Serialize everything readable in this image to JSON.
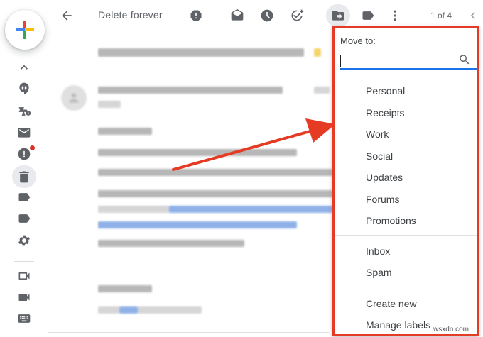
{
  "toolbar": {
    "back_icon": "arrow-left-icon",
    "delete_forever_label": "Delete forever",
    "report_spam_icon": "report-spam-icon",
    "mark_unread_icon": "mark-unread-icon",
    "snooze_icon": "clock-icon",
    "add_to_tasks_icon": "add-task-icon",
    "move_to_icon": "move-to-folder-icon",
    "labels_icon": "label-icon",
    "more_icon": "more-vertical-icon",
    "pager_text": "1 of 4",
    "prev_icon": "chevron-left-icon"
  },
  "rail": {
    "compose_icon": "compose-plus-icon",
    "icons": [
      "chevron-up-icon",
      "hangouts-icon",
      "snoozed-icon",
      "mail-icon",
      "important-icon",
      "trash-icon",
      "label-icon",
      "label-icon",
      "settings-icon",
      "video-icon",
      "meet-icon",
      "keyboard-icon"
    ]
  },
  "move_to": {
    "title": "Move to:",
    "search_value": "",
    "labels": [
      "Personal",
      "Receipts",
      "Work",
      "Social",
      "Updates",
      "Forums",
      "Promotions"
    ],
    "system_folders": [
      "Inbox",
      "Spam"
    ],
    "actions": [
      "Create new",
      "Manage labels"
    ]
  },
  "watermark": "wsxdn.com",
  "colors": {
    "annotation_red": "#e53b24",
    "focus_blue": "#1a73e8",
    "icon_gray": "#5f6368"
  }
}
